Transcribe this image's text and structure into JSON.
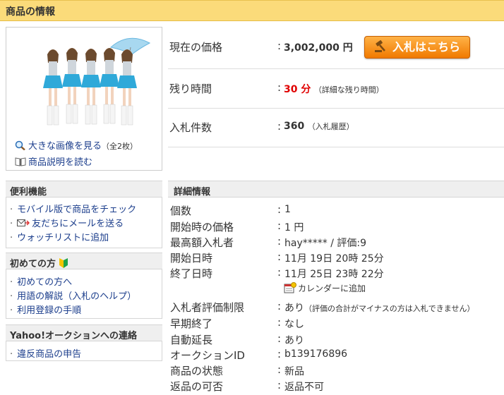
{
  "header": {
    "title": "商品の情報"
  },
  "image_panel": {
    "large_image_link": "大きな画像を見る",
    "large_image_count": "（全2枚）",
    "description_link": "商品説明を読む"
  },
  "price": {
    "label": "現在の価格",
    "value": "3,002,000 円",
    "bid_button": "入札はこちら"
  },
  "time_left": {
    "label": "残り時間",
    "value": "30 分",
    "detail_link": "（詳細な残り時間）"
  },
  "bids": {
    "label": "入札件数",
    "value": "360",
    "history_link": "（入札履歴）"
  },
  "convenience": {
    "title": "便利機能",
    "items": [
      "モバイル版で商品をチェック",
      "友だちにメールを送る",
      "ウォッチリストに追加"
    ]
  },
  "beginners": {
    "title": "初めての方",
    "items": [
      "初めての方へ",
      "用語の解説（入札のヘルプ）",
      "利用登録の手順"
    ]
  },
  "contact": {
    "title": "Yahoo!オークションへの連絡",
    "items": [
      "違反商品の申告"
    ]
  },
  "details": {
    "title": "詳細情報",
    "rows": [
      {
        "label": "個数",
        "value": "1"
      },
      {
        "label": "開始時の価格",
        "value": "1 円"
      },
      {
        "label": "最高額入札者",
        "value": "hay***** / 評価:9"
      },
      {
        "label": "開始日時",
        "value": "11月 19日 20時 25分"
      },
      {
        "label": "終了日時",
        "value": "11月 25日 23時 22分"
      },
      {
        "label": "入札者評価制限",
        "value": "あり",
        "note": "（評価の合計がマイナスの方は入札できません）"
      },
      {
        "label": "早期終了",
        "value": "なし"
      },
      {
        "label": "自動延長",
        "value": "あり"
      },
      {
        "label": "オークションID",
        "value": "b139176896"
      },
      {
        "label": "商品の状態",
        "value": "新品"
      },
      {
        "label": "返品の可否",
        "value": "返品不可"
      }
    ],
    "calendar_link": "カレンダーに追加"
  },
  "colors": {
    "header_bg": "#fbdb7a",
    "link": "#1c3e8c",
    "accent_red": "#e00000",
    "button_orange": "#f07a00"
  }
}
